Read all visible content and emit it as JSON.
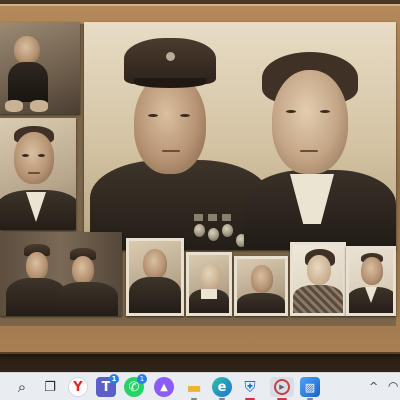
{
  "window": {
    "content": "old family photo collage in a wooden frame"
  },
  "photos": {
    "main": {
      "subject": "soldier and woman portrait"
    },
    "baby": {
      "subject": "baby"
    },
    "man_left": {
      "subject": "man in suit"
    },
    "soldiers_pair": {
      "subject": "two soldiers"
    },
    "soldier_small": {
      "subject": "soldier"
    },
    "boy": {
      "subject": "boy"
    },
    "man_center": {
      "subject": "man"
    },
    "woman_right": {
      "subject": "woman"
    },
    "man_right": {
      "subject": "man in suit"
    }
  },
  "taskbar": {
    "items": [
      {
        "name": "search",
        "icon": "search-icon",
        "glyph": "⌕"
      },
      {
        "name": "task-view",
        "icon": "task-view-icon",
        "glyph": "❐"
      },
      {
        "name": "yandex-browser",
        "icon": "yandex-icon",
        "glyph": "Y"
      },
      {
        "name": "teams",
        "icon": "teams-icon",
        "glyph": "T",
        "badge": "1"
      },
      {
        "name": "whatsapp",
        "icon": "whatsapp-icon",
        "glyph": "✆",
        "badge": "1"
      },
      {
        "name": "purple-app",
        "icon": "purple-app-icon",
        "glyph": "▲"
      },
      {
        "name": "file-explorer",
        "icon": "folder-icon",
        "glyph": "▬"
      },
      {
        "name": "edge",
        "icon": "edge-icon",
        "glyph": "e"
      },
      {
        "name": "security",
        "icon": "shield-icon",
        "glyph": "⛨"
      },
      {
        "name": "media-player",
        "icon": "play-icon",
        "glyph": "▶"
      },
      {
        "name": "photos",
        "icon": "photos-icon",
        "glyph": "▨"
      }
    ],
    "tray": {
      "chevron": "^",
      "wifi": "◠"
    },
    "colors": {
      "background": "#e9edf2",
      "active_indicator": "#d0363d",
      "badge": "#2b7de9"
    }
  }
}
